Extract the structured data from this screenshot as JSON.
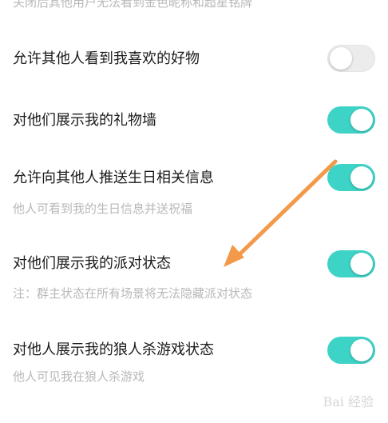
{
  "top_notice": "关闭后其他用户无法看到金色昵称和超星铭牌",
  "settings": [
    {
      "label": "允许其他人看到我喜欢的好物",
      "sub": "",
      "enabled": false
    },
    {
      "label": "对他们展示我的礼物墙",
      "sub": "",
      "enabled": true
    },
    {
      "label": "允许向其他人推送生日相关信息",
      "sub": "他人可看到我的生日信息并送祝福",
      "enabled": true
    },
    {
      "label": "对他们展示我的派对状态",
      "sub": "注：群主状态在所有场景将无法隐藏派对状态",
      "enabled": true
    },
    {
      "label": "对他人展示我的狼人杀游戏状态",
      "sub": "他人可见我在狼人杀游戏",
      "enabled": true
    }
  ],
  "colors": {
    "toggle_on": "#3ed3c7",
    "toggle_off": "#ececec",
    "annotation_arrow": "#f29a4a"
  },
  "watermark": "Bai 经验"
}
